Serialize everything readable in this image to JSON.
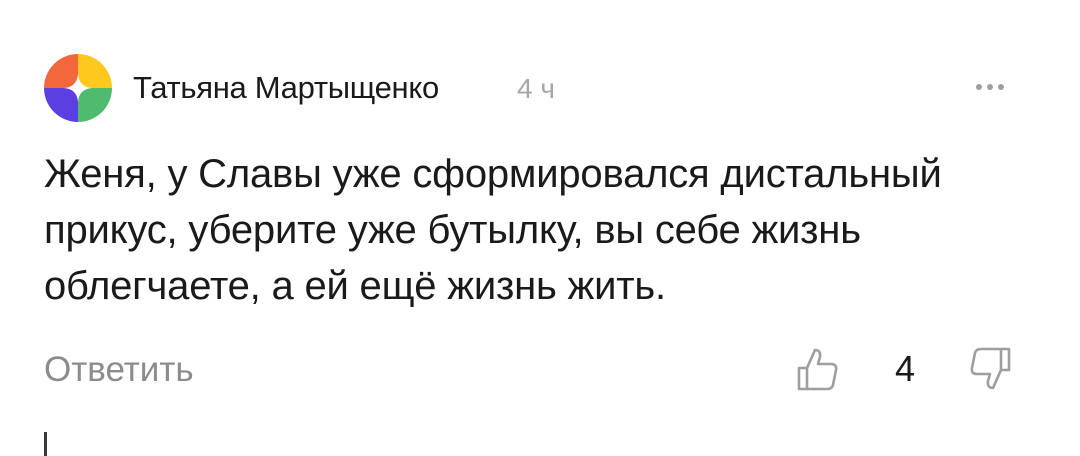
{
  "comment": {
    "author": {
      "name": "Татьяна Мартыщенко",
      "avatar_icon": "multicolor-avatar-icon",
      "avatar_colors": {
        "top_left": "#f2673c",
        "top_right": "#ffc81e",
        "bottom_left": "#5b3fe0",
        "bottom_right": "#4fbb6e"
      }
    },
    "timestamp": "4 ч",
    "text": "Женя, у Славы уже сформировался дистальный прикус, уберите уже бутылку, вы себе жизнь облегчаете, а ей ещё жизнь жить.",
    "actions": {
      "reply_label": "Ответить",
      "like_icon": "thumbs-up-icon",
      "like_count": "4",
      "dislike_icon": "thumbs-down-icon",
      "more_icon": "more-dots-icon"
    }
  },
  "colors": {
    "text": "#1a1a1a",
    "muted_text": "#8c8c8c",
    "timestamp": "#a6a6a6",
    "icon_stroke": "#9e9e9e"
  }
}
